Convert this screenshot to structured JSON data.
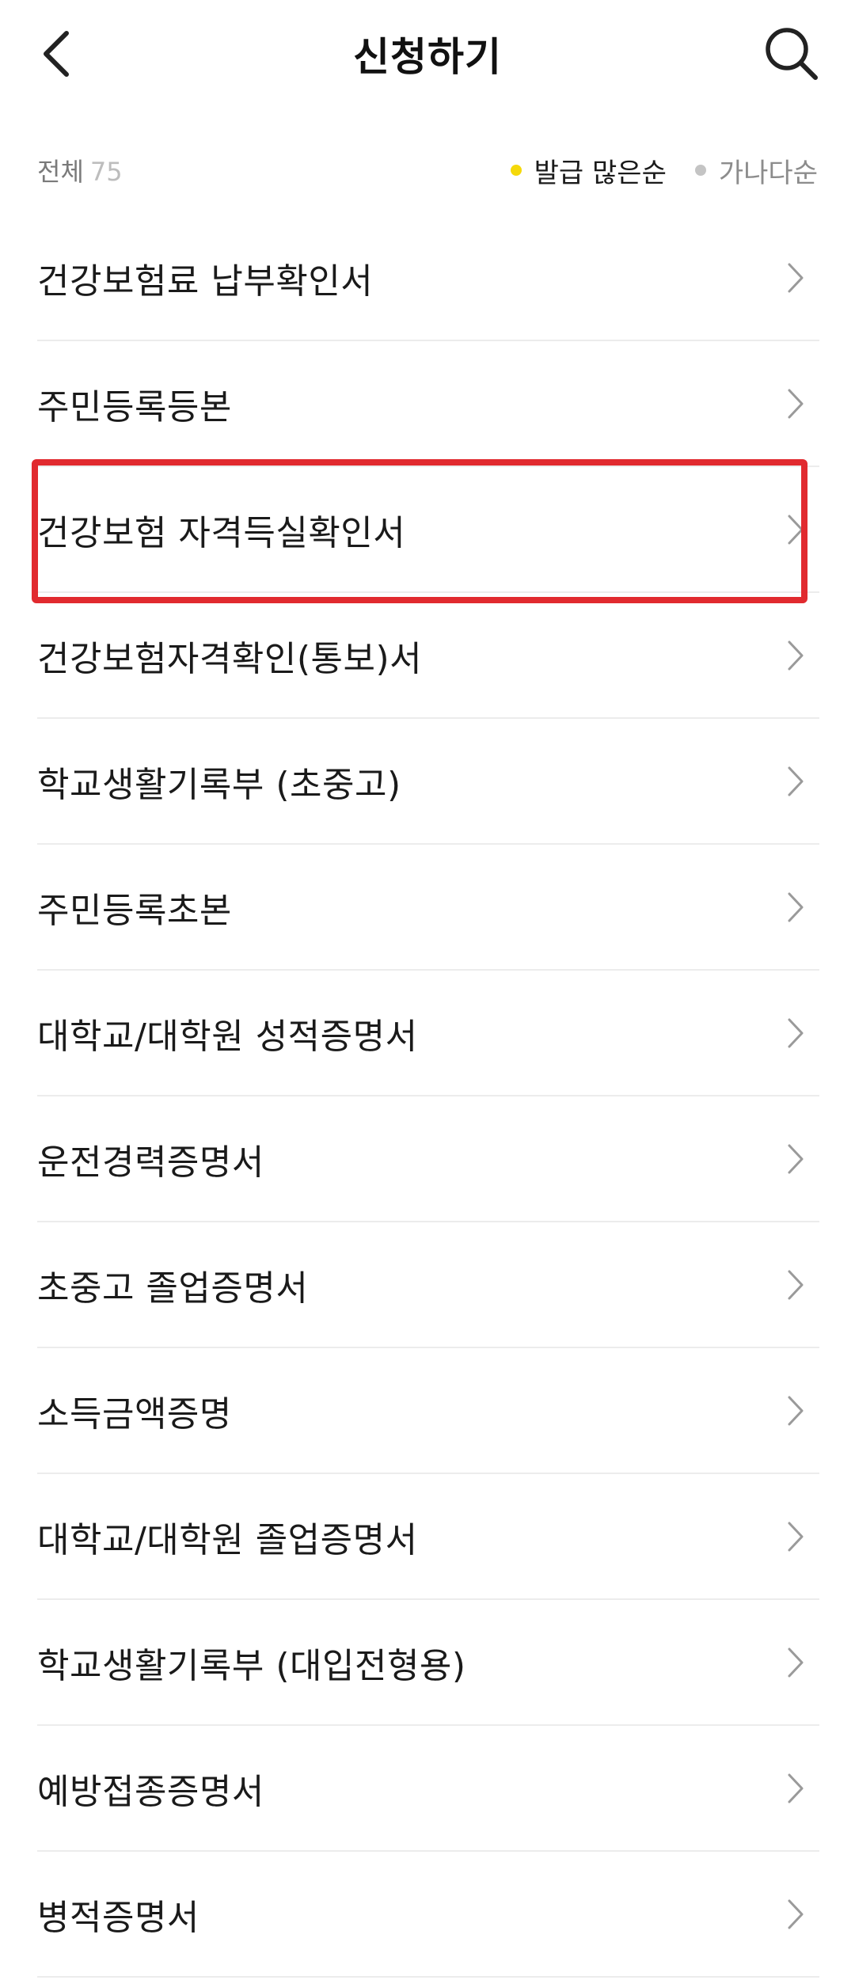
{
  "header": {
    "title": "신청하기"
  },
  "filter": {
    "total_label": "전체",
    "total_count": "75",
    "sort_options": [
      {
        "label": "발급 많은순",
        "active": true,
        "dot_color": "#f5d90a"
      },
      {
        "label": "가나다순",
        "active": false,
        "dot_color": "#c4c4c4"
      }
    ]
  },
  "documents": [
    {
      "label": "건강보험료 납부확인서"
    },
    {
      "label": "주민등록등본"
    },
    {
      "label": "건강보험 자격득실확인서"
    },
    {
      "label": "건강보험자격확인(통보)서"
    },
    {
      "label": "학교생활기록부 (초중고)"
    },
    {
      "label": "주민등록초본"
    },
    {
      "label": "대학교/대학원 성적증명서"
    },
    {
      "label": "운전경력증명서"
    },
    {
      "label": "초중고 졸업증명서"
    },
    {
      "label": "소득금액증명"
    },
    {
      "label": "대학교/대학원 졸업증명서"
    },
    {
      "label": "학교생활기록부 (대입전형용)"
    },
    {
      "label": "예방접종증명서"
    },
    {
      "label": "병적증명서"
    }
  ],
  "colors": {
    "highlight": "#e12a2f",
    "accent_yellow": "#f5d90a",
    "divider": "#ececec"
  }
}
